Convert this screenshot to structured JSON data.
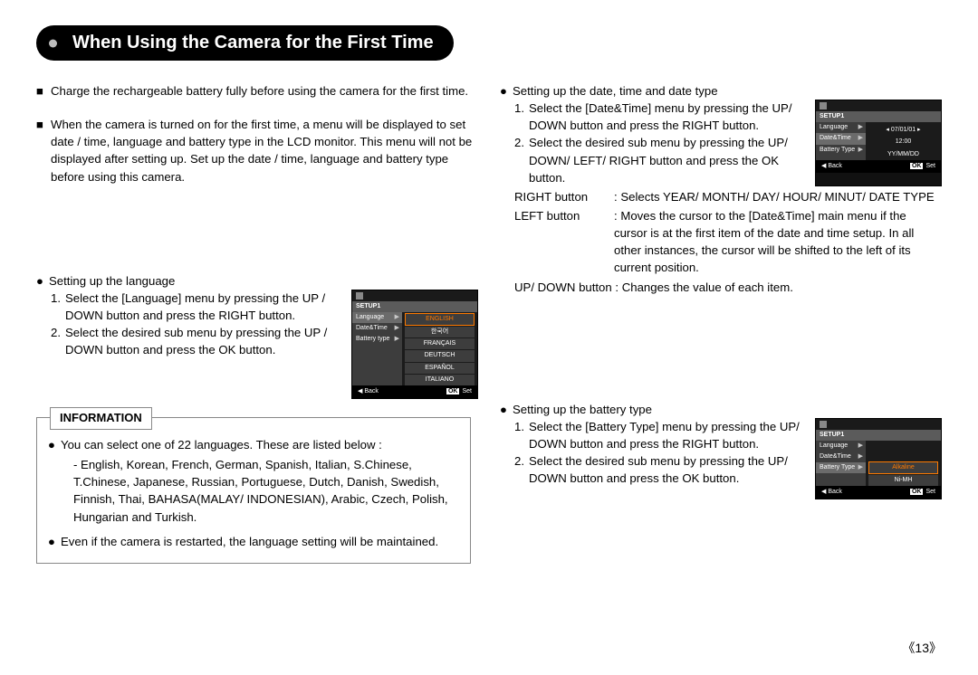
{
  "title": "When Using the Camera for the First Time",
  "left": {
    "para1": "Charge the rechargeable battery fully before using the camera for the first time.",
    "para2": "When the camera is turned on for the first time, a menu will be displayed to set date / time, language and battery type in the LCD monitor. This menu will not be displayed after setting up. Set up the date / time, language and battery type before using this camera.",
    "lang_head": "Setting up the language",
    "lang_1": "Select the [Language] menu by pressing the UP / DOWN button and press the RIGHT button.",
    "lang_2": "Select the desired sub menu by pressing the UP / DOWN button and press the OK button.",
    "info_header": "INFORMATION",
    "info_1": "You can select one of 22 languages. These are listed below :",
    "info_langs": "- English, Korean, French, German, Spanish, Italian, S.Chinese, T.Chinese, Japanese, Russian, Portuguese, Dutch, Danish, Swedish, Finnish, Thai, BAHASA(MALAY/ INDONESIAN), Arabic, Czech, Polish, Hungarian and Turkish.",
    "info_2": "Even if the camera is restarted, the language setting will be maintained."
  },
  "right": {
    "dt_head": "Setting up the date, time and date type",
    "dt_1": "Select the [Date&Time] menu by pressing the UP/ DOWN button and press the RIGHT button.",
    "dt_2": "Select the desired sub menu by pressing the UP/ DOWN/ LEFT/ RIGHT button and press the OK button.",
    "rb_label": "RIGHT button",
    "rb_text": ": Selects YEAR/ MONTH/ DAY/ HOUR/ MINUT/ DATE TYPE",
    "lb_label": "LEFT button",
    "lb_text": ": Moves the cursor to the [Date&Time] main menu if the cursor is at the first item of the date and time setup. In all other instances, the cursor will be shifted to the left of its current position.",
    "ud_text": "UP/ DOWN button : Changes the value of each item.",
    "bt_head": "Setting up the battery type",
    "bt_1": "Select the [Battery Type] menu by pressing the UP/ DOWN button and press the RIGHT button.",
    "bt_2": "Select the desired sub menu by pressing the UP/ DOWN button and press the OK button."
  },
  "lcd_common": {
    "setup": "SETUP1",
    "language": "Language",
    "datetime": "Date&Time",
    "battery": "Battery Type",
    "battery2": "Battery type",
    "back": "Back",
    "ok": "OK",
    "set": "Set"
  },
  "lcd_lang": {
    "opts": [
      "ENGLISH",
      "한국어",
      "FRANÇAIS",
      "DEUTSCH",
      "ESPAÑOL",
      "ITALIANO"
    ]
  },
  "lcd_dt": {
    "date": "07/01/01",
    "time": "12:00",
    "fmt": "YY/MM/DD"
  },
  "lcd_bt": {
    "opt1": "Alkaline",
    "opt2": "Ni-MH"
  },
  "page": "《13》"
}
